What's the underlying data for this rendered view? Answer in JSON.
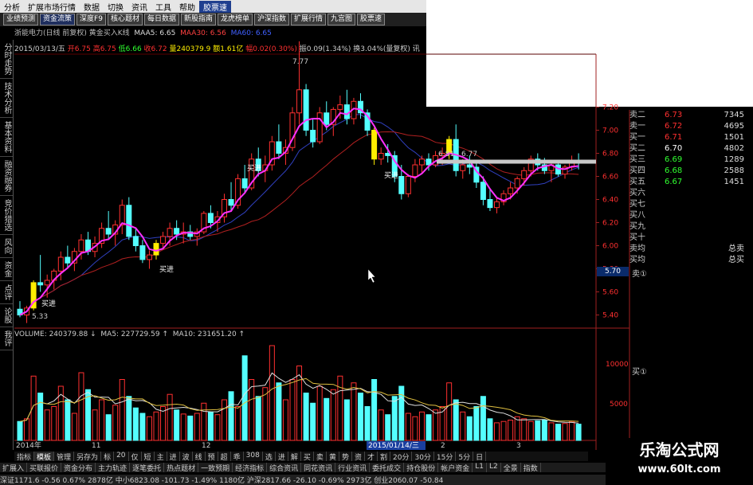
{
  "menubar": {
    "items": [
      "分析",
      "扩展市场行情",
      "数据",
      "切换",
      "资讯",
      "工具",
      "帮助",
      "胶票速"
    ]
  },
  "toolbar": {
    "items": [
      "业绩预测",
      "资金流策",
      "深度F9",
      "核心题材",
      "每日数据",
      "新股指南",
      "龙虎榜单",
      "沪深指数",
      "扩展行情",
      "九宫图",
      "胶票速"
    ]
  },
  "chart_header": {
    "title": "浙能电力(日线 前复权) 黄金买入K线",
    "ma5_label": "MAA5: 6.65",
    "ma30_label": "MAA30: 6.56",
    "ma60_label": "MA60: 6.65"
  },
  "infoline": {
    "date": "2015/03/13/五",
    "open": "开6.75",
    "high": "高6.75",
    "low": "低6.66",
    "close": "收6.72",
    "volume": "量240379.9",
    "amount": "额1.61亿",
    "change": "幅0.02(0.30%)",
    "amplitude": "振0.09(1.34%)",
    "turnover": "换3.04%(量复权)",
    "suffix": "讯"
  },
  "left_tabs": [
    "分时走势",
    "技术分析",
    "基本资料",
    "融资融券",
    "竞价猎选",
    "风向",
    "资金",
    "点评",
    "论股",
    "我评"
  ],
  "price_axis": {
    "ticks": [
      "7.20",
      "7.00",
      "6.80",
      "6.60",
      "6.40",
      "6.20",
      "6.00",
      "5.80",
      "5.70",
      "5.60",
      "5.40"
    ]
  },
  "annotations": {
    "high_mark": "7.77",
    "low_mark": "5.33",
    "range_label": "6.81 - 6.77",
    "buy1": "买进",
    "buy2": "买进",
    "buy3": "买进",
    "buy4": "买进"
  },
  "current_price_tag": "5.70",
  "orderbook": {
    "rows": [
      {
        "name": "卖二",
        "price": "6.73",
        "vol": "7345",
        "color": "#ff3030"
      },
      {
        "name": "卖一",
        "price": "6.72",
        "vol": "4695",
        "color": "#ff3030"
      },
      {
        "name": "买一",
        "price": "6.71",
        "vol": "1501",
        "color": "#ff3030"
      },
      {
        "name": "买二",
        "price": "6.70",
        "vol": "4802",
        "color": "#ffffff"
      },
      {
        "name": "买三",
        "price": "6.69",
        "vol": "1289",
        "color": "#30ff30"
      },
      {
        "name": "买四",
        "price": "6.68",
        "vol": "2588",
        "color": "#30ff30"
      },
      {
        "name": "买五",
        "price": "6.67",
        "vol": "1451",
        "color": "#30ff30"
      },
      {
        "name": "买六",
        "price": "",
        "vol": "",
        "color": "#ccc"
      },
      {
        "name": "买七",
        "price": "",
        "vol": "",
        "color": "#ccc"
      },
      {
        "name": "买八",
        "price": "",
        "vol": "",
        "color": "#ccc"
      },
      {
        "name": "买九",
        "price": "",
        "vol": "",
        "color": "#ccc"
      },
      {
        "name": "买十",
        "price": "",
        "vol": "",
        "color": "#ccc"
      },
      {
        "name": "卖均",
        "price": "",
        "vol": "总卖",
        "color": "#ccc"
      },
      {
        "name": "买均",
        "price": "",
        "vol": "总买",
        "color": "#ccc"
      }
    ],
    "sell_indicator": "卖①",
    "buy_indicator": "买①"
  },
  "volume": {
    "header_vol": "VOLUME: 240379.88 ↓",
    "header_ma5": "MA5: 227729.59 ↑",
    "header_ma10": "MA10: 231651.20 ↑",
    "axis_max": "10000",
    "axis_mid": "",
    "axis_low": "5000"
  },
  "date_axis": {
    "labels": [
      "2014年",
      "11",
      "12",
      "2015/01/14/三",
      "2",
      "3"
    ]
  },
  "tabbar1": [
    "指标",
    "模板",
    "管理",
    "另存为",
    "标",
    "20",
    "仅",
    "短",
    "主",
    "进",
    "波",
    "线",
    "预",
    "超",
    "乖",
    "308",
    "选",
    "进",
    "解",
    "买",
    "卖",
    "黄",
    "势",
    "资",
    "才",
    "割",
    "20分",
    "30分",
    "15分",
    "5分",
    "日"
  ],
  "tabbar2": [
    "扩展入",
    "买联报价",
    "资金分布",
    "主力轨迹",
    "逐笔委托",
    "热点题材",
    "一致预期",
    "经济指标",
    "综合资讯",
    "同花资讯",
    "行业资讯",
    "委托成交",
    "持仓股份",
    "帐户资金",
    "L1",
    "L2",
    "全景",
    "指数"
  ],
  "statusbar": "深证1171.6  -0.56  0.67%  2878亿  中小6823.08  -101.73  -1.49%  1180亿  沪深2817.66  -26.10  -0.69%  2973亿  创业2060.07  -50.84",
  "watermark": {
    "title": "乐淘公式网",
    "url": "www.60lt.com"
  },
  "chart_data": {
    "type": "candlestick",
    "price_range": [
      5.3,
      7.3
    ],
    "candles": [
      [
        5.45,
        5.52,
        5.38,
        5.4
      ],
      [
        5.4,
        5.48,
        5.33,
        5.46
      ],
      [
        5.46,
        5.7,
        5.44,
        5.68
      ],
      [
        5.68,
        5.92,
        5.6,
        5.66
      ],
      [
        5.66,
        5.75,
        5.55,
        5.7
      ],
      [
        5.7,
        5.8,
        5.62,
        5.78
      ],
      [
        5.78,
        5.95,
        5.7,
        5.9
      ],
      [
        5.9,
        6.0,
        5.8,
        5.85
      ],
      [
        5.85,
        5.98,
        5.78,
        5.95
      ],
      [
        5.95,
        6.1,
        5.88,
        6.05
      ],
      [
        6.05,
        6.12,
        5.92,
        5.95
      ],
      [
        5.95,
        6.08,
        5.9,
        6.02
      ],
      [
        6.02,
        6.2,
        5.98,
        6.15
      ],
      [
        6.15,
        6.3,
        6.05,
        6.1
      ],
      [
        6.1,
        6.22,
        6.0,
        6.18
      ],
      [
        6.18,
        6.4,
        6.1,
        6.35
      ],
      [
        6.35,
        6.42,
        6.05,
        6.08
      ],
      [
        6.08,
        6.15,
        5.95,
        6.0
      ],
      [
        6.0,
        6.05,
        5.85,
        5.88
      ],
      [
        5.88,
        5.96,
        5.8,
        5.92
      ],
      [
        5.92,
        6.05,
        5.88,
        6.02
      ],
      [
        6.02,
        6.12,
        5.98,
        6.08
      ],
      [
        6.08,
        6.2,
        6.0,
        6.15
      ],
      [
        6.15,
        6.22,
        6.05,
        6.1
      ],
      [
        6.1,
        6.2,
        6.02,
        6.12
      ],
      [
        6.12,
        6.18,
        6.05,
        6.08
      ],
      [
        6.08,
        6.15,
        6.0,
        6.12
      ],
      [
        6.12,
        6.3,
        6.1,
        6.28
      ],
      [
        6.28,
        6.35,
        6.15,
        6.2
      ],
      [
        6.2,
        6.3,
        6.12,
        6.25
      ],
      [
        6.25,
        6.45,
        6.2,
        6.4
      ],
      [
        6.4,
        6.55,
        6.3,
        6.35
      ],
      [
        6.35,
        6.62,
        6.32,
        6.58
      ],
      [
        6.58,
        6.7,
        6.45,
        6.5
      ],
      [
        6.5,
        6.8,
        6.48,
        6.75
      ],
      [
        6.75,
        6.85,
        6.6,
        6.65
      ],
      [
        6.65,
        6.78,
        6.55,
        6.7
      ],
      [
        6.7,
        6.95,
        6.65,
        6.9
      ],
      [
        6.9,
        7.05,
        6.75,
        6.8
      ],
      [
        6.8,
        6.92,
        6.7,
        6.85
      ],
      [
        6.85,
        7.2,
        6.82,
        7.15
      ],
      [
        7.15,
        7.77,
        7.05,
        7.35
      ],
      [
        7.35,
        7.4,
        6.95,
        7.0
      ],
      [
        7.0,
        7.1,
        6.85,
        6.9
      ],
      [
        6.9,
        7.2,
        6.88,
        7.15
      ],
      [
        7.15,
        7.25,
        7.0,
        7.05
      ],
      [
        7.05,
        7.2,
        6.95,
        7.18
      ],
      [
        7.18,
        7.3,
        7.1,
        7.22
      ],
      [
        7.22,
        7.35,
        7.05,
        7.1
      ],
      [
        7.1,
        7.28,
        7.05,
        7.25
      ],
      [
        7.25,
        7.32,
        7.1,
        7.15
      ],
      [
        7.15,
        7.18,
        6.95,
        7.0
      ],
      [
        7.0,
        7.02,
        6.7,
        6.75
      ],
      [
        6.75,
        6.85,
        6.7,
        6.8
      ],
      [
        6.8,
        6.88,
        6.72,
        6.78
      ],
      [
        6.78,
        6.82,
        6.55,
        6.6
      ],
      [
        6.6,
        6.7,
        6.4,
        6.45
      ],
      [
        6.45,
        6.62,
        6.42,
        6.6
      ],
      [
        6.6,
        6.75,
        6.55,
        6.7
      ],
      [
        6.7,
        6.78,
        6.62,
        6.75
      ],
      [
        6.75,
        6.8,
        6.65,
        6.7
      ],
      [
        6.7,
        6.82,
        6.68,
        6.78
      ],
      [
        6.78,
        6.85,
        6.7,
        6.8
      ],
      [
        6.8,
        6.95,
        6.75,
        6.92
      ],
      [
        6.92,
        7.05,
        6.6,
        6.65
      ],
      [
        6.65,
        6.75,
        6.58,
        6.7
      ],
      [
        6.7,
        6.78,
        6.62,
        6.68
      ],
      [
        6.68,
        6.72,
        6.5,
        6.55
      ],
      [
        6.55,
        6.6,
        6.35,
        6.4
      ],
      [
        6.4,
        6.5,
        6.3,
        6.33
      ],
      [
        6.33,
        6.42,
        6.28,
        6.38
      ],
      [
        6.38,
        6.48,
        6.35,
        6.45
      ],
      [
        6.45,
        6.55,
        6.4,
        6.5
      ],
      [
        6.5,
        6.6,
        6.45,
        6.58
      ],
      [
        6.58,
        6.68,
        6.52,
        6.65
      ],
      [
        6.65,
        6.78,
        6.6,
        6.75
      ],
      [
        6.75,
        6.8,
        6.65,
        6.7
      ],
      [
        6.7,
        6.76,
        6.62,
        6.65
      ],
      [
        6.65,
        6.72,
        6.55,
        6.7
      ],
      [
        6.7,
        6.74,
        6.6,
        6.62
      ],
      [
        6.62,
        6.7,
        6.58,
        6.68
      ],
      [
        6.68,
        6.78,
        6.65,
        6.74
      ],
      [
        6.74,
        6.8,
        6.66,
        6.72
      ]
    ],
    "volumes": [
      2.8,
      3.2,
      9.5,
      7.0,
      4.5,
      5.0,
      8.0,
      6.0,
      4.0,
      10.0,
      7.5,
      4.5,
      6.0,
      3.8,
      5.2,
      9.0,
      6.5,
      4.8,
      4.0,
      3.5,
      4.2,
      5.0,
      6.8,
      4.5,
      3.9,
      3.6,
      4.0,
      5.5,
      4.2,
      3.8,
      6.0,
      7.2,
      5.0,
      12.5,
      9.0,
      6.5,
      7.8,
      14.0,
      8.5,
      6.0,
      9.0,
      11.0,
      7.0,
      5.5,
      8.0,
      6.2,
      7.5,
      9.5,
      6.0,
      8.5,
      7.0,
      5.0,
      9.0,
      4.5,
      3.8,
      6.5,
      8.0,
      4.0,
      3.5,
      4.2,
      3.8,
      4.5,
      5.0,
      8.5,
      6.0,
      4.2,
      3.5,
      5.0,
      6.5,
      3.2,
      2.6,
      2.8,
      3.0,
      3.5,
      3.2,
      2.8,
      2.9,
      3.0,
      2.6,
      2.4,
      2.5,
      2.8,
      2.4
    ],
    "up_color": "#ff3030",
    "down_color": "#54ffff",
    "yellow_signal_color": "#ffee00",
    "ma5_color": "#ff30ff",
    "ma30_color": "#b02020",
    "ma60_color": "#3040c0"
  }
}
